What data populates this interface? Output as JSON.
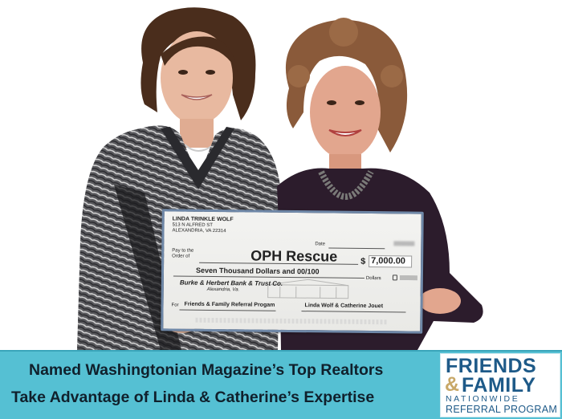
{
  "check": {
    "payer_name": "LINDA TRINKLE WOLF",
    "payer_address_1": "513 N ALFRED ST",
    "payer_address_2": "ALEXANDRIA, VA 22314",
    "date_label": "Date",
    "pay_to_label": "Pay to the Order of",
    "payee": "OPH Rescue",
    "dollar_sign": "$",
    "amount": "7,000.00",
    "amount_words": "Seven Thousand Dollars and 00/100",
    "dollars_label": "Dollars",
    "bank_name": "Burke & Herbert Bank & Trust Co.",
    "bank_city": "Alexandria, Va.",
    "for_label": "For",
    "memo": "Friends & Family Referral Progam",
    "signature": "Linda Wolf & Catherine Jouet"
  },
  "banner": {
    "tagline_1": "Named Washingtonian Magazine’s Top Realtors",
    "tagline_2": "Take Advantage of Linda & Catherine’s Expertise",
    "background_color": "#55c0d3"
  },
  "logo": {
    "line_1": "FRIENDS",
    "ampersand": "&",
    "line_2": "FAMILY",
    "line_3": "NATIONWIDE",
    "line_4": "REFERRAL PROGRAM",
    "color_primary": "#1e5a88",
    "color_accent": "#c8a868"
  }
}
